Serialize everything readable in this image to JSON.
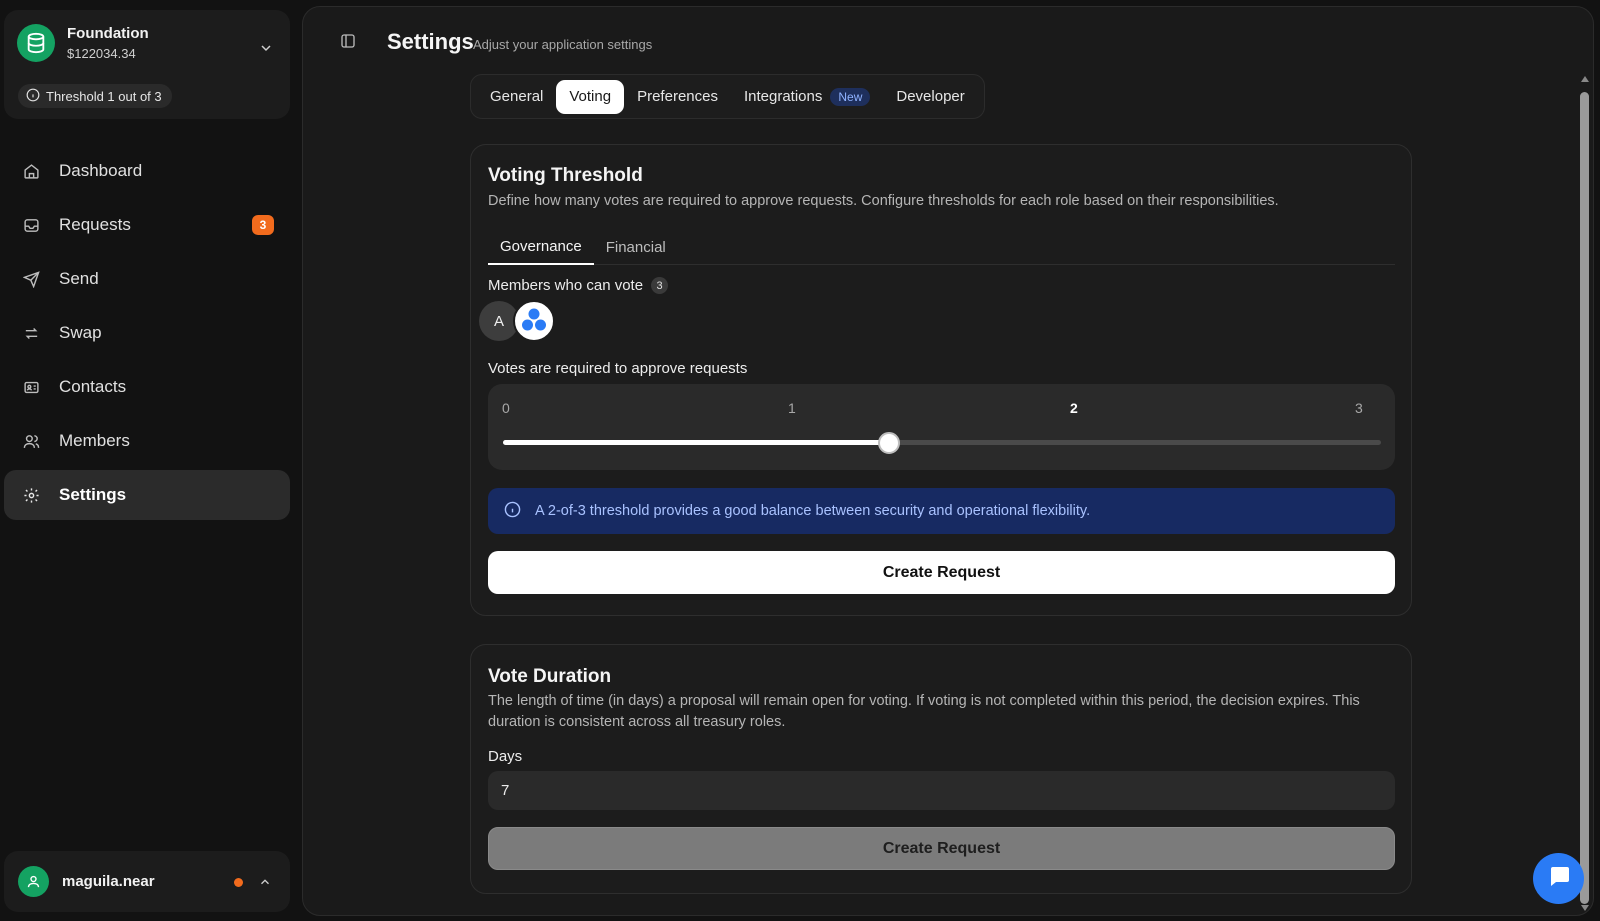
{
  "sidebar": {
    "treasury": {
      "name": "Foundation",
      "balance": "$122034.34",
      "threshold": "Threshold 1 out of 3"
    },
    "items": [
      {
        "label": "Dashboard",
        "icon": "home-icon"
      },
      {
        "label": "Requests",
        "icon": "inbox-icon",
        "badge": "3"
      },
      {
        "label": "Send",
        "icon": "send-icon"
      },
      {
        "label": "Swap",
        "icon": "swap-icon"
      },
      {
        "label": "Contacts",
        "icon": "contact-card-icon"
      },
      {
        "label": "Members",
        "icon": "users-icon"
      },
      {
        "label": "Settings",
        "icon": "gear-icon",
        "active": true
      }
    ],
    "user": {
      "name": "maguila.near"
    }
  },
  "header": {
    "title": "Settings",
    "subtitle": "Adjust your application settings"
  },
  "tabs": [
    {
      "label": "General"
    },
    {
      "label": "Voting",
      "active": true
    },
    {
      "label": "Preferences"
    },
    {
      "label": "Integrations",
      "badge": "New"
    },
    {
      "label": "Developer"
    }
  ],
  "voting_threshold": {
    "title": "Voting Threshold",
    "description": "Define how many votes are required to approve requests. Configure thresholds for each role based on their responsibilities.",
    "subtabs": [
      {
        "label": "Governance",
        "active": true
      },
      {
        "label": "Financial"
      }
    ],
    "members_label": "Members who can vote",
    "members_count": "3",
    "members": [
      {
        "initial": "A"
      }
    ],
    "votes_label": "Votes are required to approve requests",
    "slider": {
      "ticks": [
        "0",
        "1",
        "2",
        "3"
      ],
      "value": 2,
      "min": 0,
      "max": 3
    },
    "info": "A 2-of-3 threshold provides a good balance between security and operational flexibility.",
    "button": "Create Request"
  },
  "vote_duration": {
    "title": "Vote Duration",
    "description": "The length of time (in days) a proposal will remain open for voting. If voting is not completed within this period, the decision expires. This duration is consistent across all treasury roles.",
    "days_label": "Days",
    "days_value": "7",
    "button": "Create Request"
  },
  "colors": {
    "brand_green": "#14a262",
    "badge_orange": "#f26b1d",
    "info_bg": "#172a62",
    "chat_blue": "#2a7bf5"
  }
}
